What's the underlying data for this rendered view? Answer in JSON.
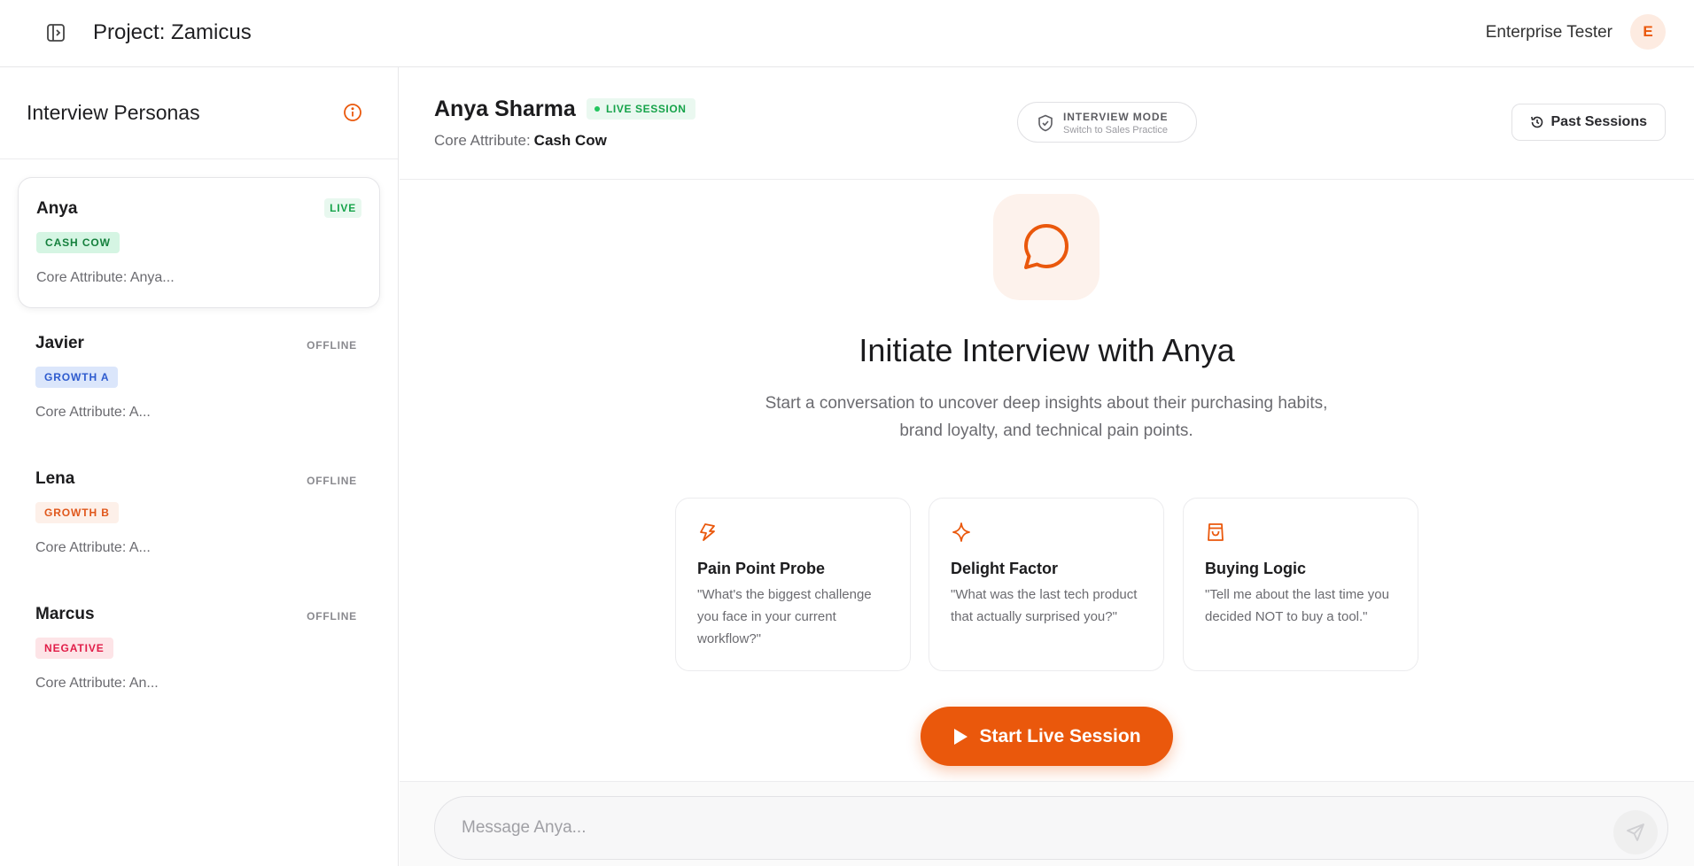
{
  "app": {
    "project_title": "Project: Zamicus",
    "user_name": "Enterprise Tester",
    "avatar_initial": "E"
  },
  "sidebar": {
    "title": "Interview Personas",
    "personas": [
      {
        "name": "Anya",
        "status": "LIVE",
        "tag": "CASH COW",
        "attr": "Core Attribute: Anya..."
      },
      {
        "name": "Javier",
        "status": "OFFLINE",
        "tag": "GROWTH A",
        "attr": "Core Attribute: A..."
      },
      {
        "name": "Lena",
        "status": "OFFLINE",
        "tag": "GROWTH B",
        "attr": "Core Attribute: A..."
      },
      {
        "name": "Marcus",
        "status": "OFFLINE",
        "tag": "NEGATIVE",
        "attr": "Core Attribute: An..."
      }
    ]
  },
  "main": {
    "persona_name": "Anya Sharma",
    "live_badge": "LIVE SESSION",
    "core_attr_label": "Core Attribute:",
    "core_attr_value": "Cash Cow",
    "mode_title": "INTERVIEW MODE",
    "mode_sub": "Switch to Sales Practice",
    "past_sessions": "Past Sessions",
    "hero_title": "Initiate Interview with Anya",
    "hero_desc": "Start a conversation to uncover deep insights about their purchasing habits, brand loyalty, and technical pain points.",
    "prompts": [
      {
        "title": "Pain Point Probe",
        "text": "\"What's the biggest challenge you face in your current workflow?\"",
        "icon": "thumbs-down-icon"
      },
      {
        "title": "Delight Factor",
        "text": "\"What was the last tech product that actually surprised you?\"",
        "icon": "sparkle-icon"
      },
      {
        "title": "Buying Logic",
        "text": "\"Tell me about the last time you decided NOT to buy a tool.\"",
        "icon": "shopping-bag-icon"
      }
    ],
    "start_button": "Start Live Session"
  },
  "composer": {
    "placeholder": "Message Anya..."
  },
  "colors": {
    "accent": "#ea580c",
    "live": "#16a34a"
  }
}
